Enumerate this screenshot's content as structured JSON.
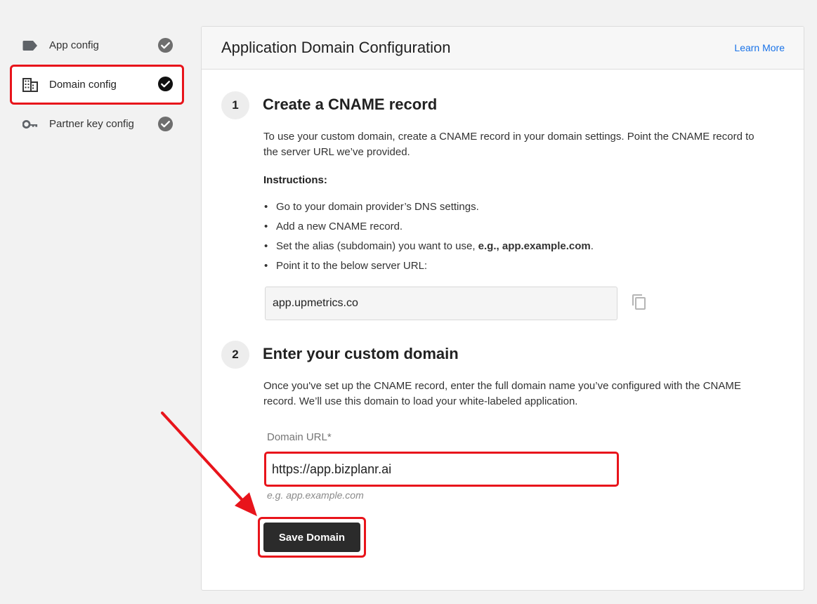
{
  "sidebar": {
    "items": [
      {
        "label": "App config"
      },
      {
        "label": "Domain config"
      },
      {
        "label": "Partner key config"
      }
    ]
  },
  "header": {
    "title": "Application Domain Configuration",
    "learn_more": "Learn More"
  },
  "step1": {
    "number": "1",
    "title": "Create a CNAME record",
    "description": "To use your custom domain, create a CNAME record in your domain settings. Point the CNAME record to the server URL we’ve provided.",
    "instructions_heading": "Instructions:",
    "bullets": {
      "b1": "Go to your domain provider’s DNS settings.",
      "b2": "Add a new CNAME record.",
      "b3_prefix": "Set the alias (subdomain) you want to use, ",
      "b3_bold": "e.g., app.example.com",
      "b3_suffix": ".",
      "b4": "Point it to the below server URL:"
    },
    "server_url": "app.upmetrics.co"
  },
  "step2": {
    "number": "2",
    "title": "Enter your custom domain",
    "description": "Once you've set up the CNAME record, enter the full domain name you’ve configured with the CNAME record. We’ll use this domain to load your white-labeled application.",
    "field_label": "Domain URL*",
    "field_value": "https://app.bizplanr.ai",
    "hint": "e.g. app.example.com",
    "save_label": "Save Domain"
  },
  "colors": {
    "highlight": "#e8141b",
    "link": "#1a73e8",
    "button": "#2b2b2b"
  }
}
